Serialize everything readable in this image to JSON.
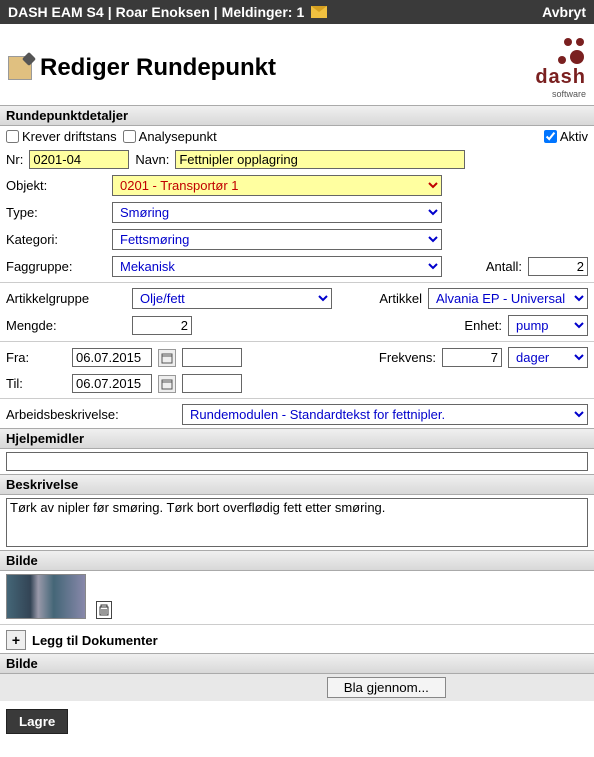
{
  "topbar": {
    "app": "DASH EAM S4",
    "user": "Roar Enoksen",
    "messages_label": "Meldinger:",
    "messages_count": "1",
    "cancel": "Avbryt"
  },
  "header": {
    "title": "Rediger Rundepunkt",
    "logo_text": "dash",
    "logo_sub": "software"
  },
  "details": {
    "legend": "Rundepunktdetaljer",
    "krever_driftstans": "Krever driftstans",
    "analysepunkt": "Analysepunkt",
    "aktiv": "Aktiv",
    "aktiv_checked": true,
    "nr_label": "Nr:",
    "nr_value": "0201-04",
    "navn_label": "Navn:",
    "navn_value": "Fettnipler opplagring",
    "objekt_label": "Objekt:",
    "objekt_value": "0201 - Transportør 1",
    "type_label": "Type:",
    "type_value": "Smøring",
    "kategori_label": "Kategori:",
    "kategori_value": "Fettsmøring",
    "faggruppe_label": "Faggruppe:",
    "faggruppe_value": "Mekanisk",
    "antall_label": "Antall:",
    "antall_value": "2",
    "artikkelgruppe_label": "Artikkelgruppe",
    "artikkelgruppe_value": "Olje/fett",
    "artikkel_label": "Artikkel",
    "artikkel_value": "Alvania EP - Universal EP-",
    "mengde_label": "Mengde:",
    "mengde_value": "2",
    "enhet_label": "Enhet:",
    "enhet_value": "pump",
    "fra_label": "Fra:",
    "fra_value": "06.07.2015",
    "frekvens_label": "Frekvens:",
    "frekvens_value": "7",
    "frekvens_unit": "dager",
    "til_label": "Til:",
    "til_value": "06.07.2015",
    "arbeidsbeskrivelse_label": "Arbeidsbeskrivelse:",
    "arbeidsbeskrivelse_value": "Rundemodulen - Standardtekst for fettnipler."
  },
  "hjelpemidler": {
    "legend": "Hjelpemidler",
    "value": ""
  },
  "beskrivelse": {
    "legend": "Beskrivelse",
    "value": "Tørk av nipler før smøring. Tørk bort overflødig fett etter smøring."
  },
  "bilde1": {
    "legend": "Bilde"
  },
  "dokumenter": {
    "add_label": "Legg til Dokumenter"
  },
  "bilde2": {
    "legend": "Bilde",
    "browse": "Bla gjennom..."
  },
  "save": "Lagre"
}
